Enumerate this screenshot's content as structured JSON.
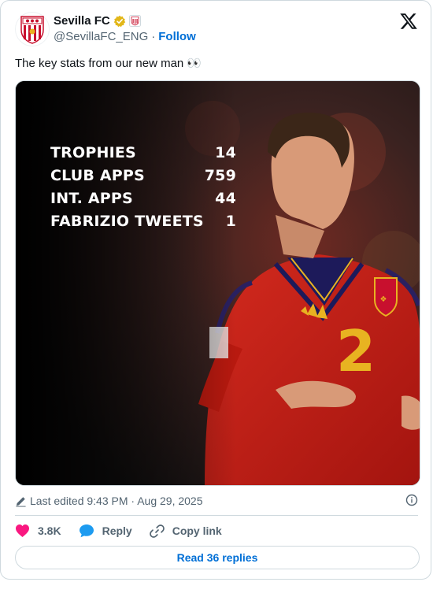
{
  "account": {
    "display_name": "Sevilla FC",
    "handle": "@SevillaFC_ENG",
    "separator": "·",
    "follow_label": "Follow"
  },
  "tweet": {
    "text": "The key stats from our new man 👀"
  },
  "media": {
    "stats": [
      {
        "label": "TROPHIES",
        "value": "14"
      },
      {
        "label": "CLUB APPS",
        "value": "759"
      },
      {
        "label": "INT. APPS",
        "value": "44"
      },
      {
        "label": "FABRIZIO TWEETS",
        "value": "1"
      }
    ],
    "shirt_number": "2"
  },
  "meta": {
    "edited_label": "Last edited 9:43 PM · Aug 29, 2025"
  },
  "actions": {
    "likes": "3.8K",
    "reply_label": "Reply",
    "copy_link_label": "Copy link"
  },
  "read_replies_label": "Read 36 replies",
  "colors": {
    "follow": "#006fd6",
    "like": "#f91880",
    "reply": "#1d9bf0",
    "muted": "#536471",
    "border": "#cfd9de"
  },
  "icons": [
    "sevilla-crest-icon",
    "verified-badge-icon",
    "affiliate-crest-icon",
    "x-logo-icon",
    "pencil-icon",
    "info-icon",
    "heart-icon",
    "reply-bubble-icon",
    "link-icon"
  ]
}
